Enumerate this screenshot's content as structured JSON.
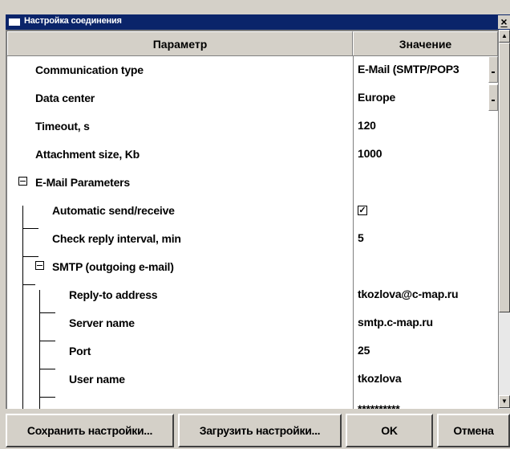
{
  "window": {
    "title": "Настройка соединения",
    "close_glyph": "×"
  },
  "header": {
    "param": "Параметр",
    "value": "Значение"
  },
  "rows": [
    {
      "label": "Communication type",
      "value": "E-Mail (SMTP/POP3",
      "control": "dropdown"
    },
    {
      "label": "Data center",
      "value": "Europe",
      "control": "dropdown"
    },
    {
      "label": "Timeout, s",
      "value": "120"
    },
    {
      "label": "Attachment size, Kb",
      "value": "1000"
    },
    {
      "label": "E-Mail Parameters",
      "value": "",
      "group": true
    },
    {
      "label": "Automatic send/receive",
      "value": "",
      "checked": true
    },
    {
      "label": "Check reply interval, min",
      "value": "5"
    },
    {
      "label": "SMTP (outgoing e-mail)",
      "value": "",
      "group": true
    },
    {
      "label": "Reply-to address",
      "value": "tkozlova@c-map.ru"
    },
    {
      "label": "Server name",
      "value": "smtp.c-map.ru"
    },
    {
      "label": "Port",
      "value": "25"
    },
    {
      "label": "User name",
      "value": "tkozlova"
    },
    {
      "label": "",
      "value": "**********"
    }
  ],
  "buttons": {
    "save": "Сохранить настройки...",
    "load": "Загрузить настройки...",
    "ok": "OK",
    "cancel": "Отмена"
  }
}
